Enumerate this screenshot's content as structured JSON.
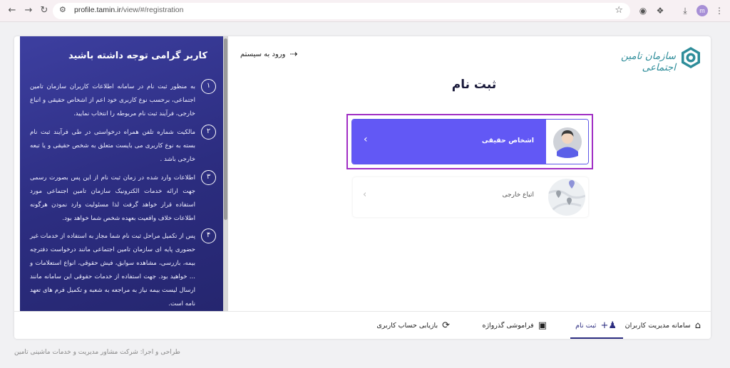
{
  "browser": {
    "url_host": "profile.tamin.ir",
    "url_path": "/view/#/registration",
    "profile_initial": "m"
  },
  "header": {
    "logo_text": "سازمان تامین اجتماعی",
    "login_label": "ورود به سیستم",
    "page_title": "ثبت نام"
  },
  "notice": {
    "title": "کاربر گرامی توجه داشته باشید",
    "items": [
      {
        "num": "۱",
        "text": "به منظور ثبت نام در سامانه اطلاعات کاربران سازمان تامین اجتماعی، برحسب نوع کاربری خود اعم از اشخاص حقیقی و اتباع خارجی، فرآیند ثبت نام مربوطه را انتخاب نمایید."
      },
      {
        "num": "۲",
        "text": "مالکیت شماره تلفن همراه درخواستی در طی فرآیند ثبت نام بسته به نوع کاربری می بایست متعلق به شخص حقیقی و یا تبعه خارجی باشد ."
      },
      {
        "num": "۳",
        "text": "اطلاعات وارد شده در زمان ثبت نام از این پس بصورت رسمی جهت ارائه خدمات الکترونیک سازمان تامین اجتماعی مورد استفاده قرار خواهد گرفت لذا مسئولیت وارد نمودن هرگونه اطلاعات خلاف واقعیت بعهده شخص شما خواهد بود."
      },
      {
        "num": "۴",
        "text": "پس از تکمیل مراحل ثبت نام شما مجاز به استفاده از خدمات غیر حضوری پایه ای سازمان تامین اجتماعی مانند درخواست دفترچه بیمه، بازرسی، مشاهده سوابق، فیش حقوقی، انواع استعلامات و ... خواهید بود. جهت استفاده از خدمات حقوقی این سامانه مانند ارسال لیست بیمه نیاز به مراجعه به شعبه و تکمیل فرم های تعهد نامه است."
      }
    ]
  },
  "options": {
    "real_person": "اشخاص حقیقی",
    "foreign_national": "اتباع خارجی"
  },
  "bottom_nav": {
    "user_management": "سامانه مدیریت کاربران",
    "register": "ثبت نام",
    "forgot_password": "فراموشی گذرواژه",
    "account_recovery": "بازیابی حساب کاربری"
  },
  "footer": "طراحی و اجرا: شرکت مشاور مدیریت و خدمات ماشینی تامین",
  "colors": {
    "primary": "#6258f5",
    "panel": "#2c2d80",
    "highlight": "#a02ec4",
    "logo": "#2e8d9a"
  }
}
